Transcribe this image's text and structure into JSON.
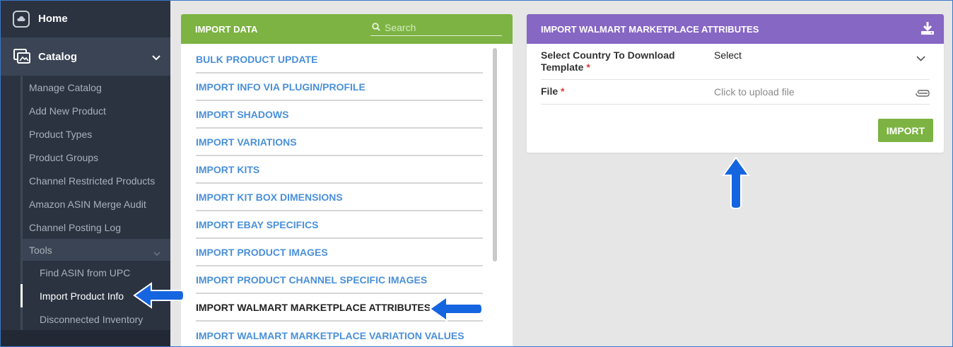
{
  "sidebar": {
    "home_label": "Home",
    "catalog_label": "Catalog",
    "catalog_items": [
      "Manage Catalog",
      "Add New Product",
      "Product Types",
      "Product Groups",
      "Channel Restricted Products",
      "Amazon ASIN Merge Audit",
      "Channel Posting Log"
    ],
    "tools_label": "Tools",
    "tools_items": [
      "Find ASIN from UPC",
      "Import Product Info",
      "Disconnected Inventory"
    ],
    "active_item": "Import Product Info"
  },
  "import_data": {
    "title": "IMPORT DATA",
    "search_placeholder": "Search",
    "items": [
      "BULK PRODUCT UPDATE",
      "IMPORT INFO VIA PLUGIN/PROFILE",
      "IMPORT SHADOWS",
      "IMPORT VARIATIONS",
      "IMPORT KITS",
      "IMPORT KIT BOX DIMENSIONS",
      "IMPORT EBAY SPECIFICS",
      "IMPORT PRODUCT IMAGES",
      "IMPORT PRODUCT CHANNEL SPECIFIC IMAGES",
      "IMPORT WALMART MARKETPLACE ATTRIBUTES",
      "IMPORT WALMART MARKETPLACE VARIATION VALUES"
    ],
    "selected_item": "IMPORT WALMART MARKETPLACE ATTRIBUTES"
  },
  "walmart_panel": {
    "title": "IMPORT WALMART MARKETPLACE ATTRIBUTES",
    "country_label_line1": "Select Country To Download",
    "country_label_line2": "Template",
    "required_mark": "*",
    "country_value": "Select",
    "file_label": "File",
    "file_placeholder": "Click to upload file",
    "import_button": "IMPORT"
  },
  "colors": {
    "sidebar_bg": "#2b3341",
    "green_header": "#7cb342",
    "purple_header": "#8667c4",
    "link_blue": "#4a90d9",
    "annotation_arrow": "#1565e0"
  }
}
